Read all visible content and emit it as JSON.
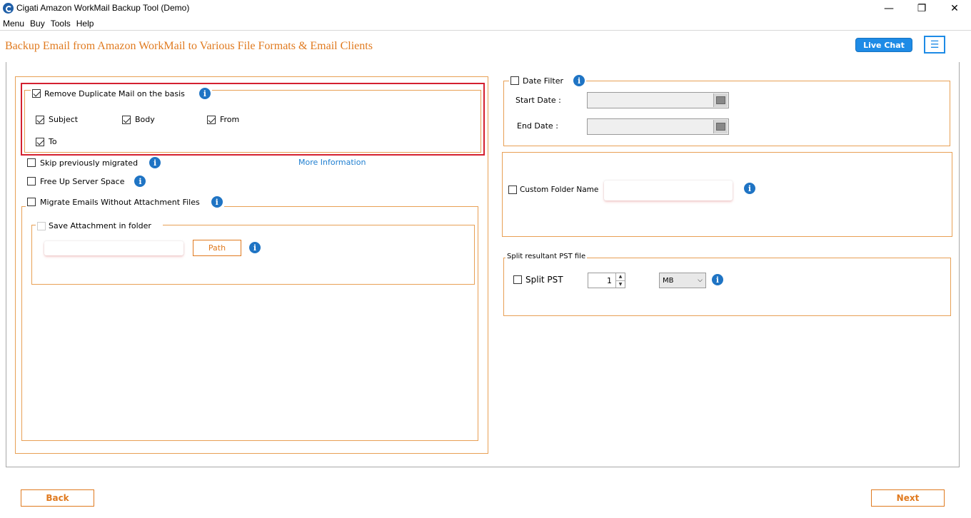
{
  "window": {
    "title": "Cigati Amazon WorkMail Backup Tool (Demo)",
    "minimize": "—",
    "restore": "❐",
    "close": "✕"
  },
  "menu": [
    "Menu",
    "Buy",
    "Tools",
    "Help"
  ],
  "header": {
    "title": "Backup Email from Amazon WorkMail to Various File Formats & Email Clients",
    "live_chat": "Live Chat",
    "hamburger": "☰"
  },
  "left": {
    "remove_duplicate": {
      "label": "Remove Duplicate Mail on the basis",
      "checked": true
    },
    "duplicate_options": [
      {
        "label": "Subject",
        "checked": true
      },
      {
        "label": "Body",
        "checked": true
      },
      {
        "label": "From",
        "checked": true
      },
      {
        "label": "To",
        "checked": true
      }
    ],
    "skip_migrated": {
      "label": "Skip previously migrated",
      "checked": false
    },
    "more_info": "More Information",
    "free_up": {
      "label": "Free Up Server Space",
      "checked": false
    },
    "migrate_without_attachments": {
      "label": "Migrate Emails Without Attachment Files",
      "checked": false
    },
    "save_attachment": {
      "label": "Save Attachment in folder",
      "checked": false
    },
    "path_value": "",
    "path_button": "Path"
  },
  "right": {
    "date_filter": {
      "label": "Date Filter",
      "checked": false
    },
    "start_date_label": "Start Date :",
    "end_date_label": "End Date :",
    "start_date_value": "",
    "end_date_value": "",
    "custom_folder": {
      "label": "Custom Folder Name",
      "checked": false
    },
    "custom_folder_value": "",
    "split_group_label": "Split resultant PST file",
    "split_pst": {
      "label": "Split PST",
      "checked": false
    },
    "split_size": "1",
    "split_unit": "MB"
  },
  "footer": {
    "back": "Back",
    "next": "Next"
  },
  "colors": {
    "accent_orange": "#e07a1f",
    "accent_blue": "#1e8be6",
    "highlight_red": "#d42030"
  }
}
